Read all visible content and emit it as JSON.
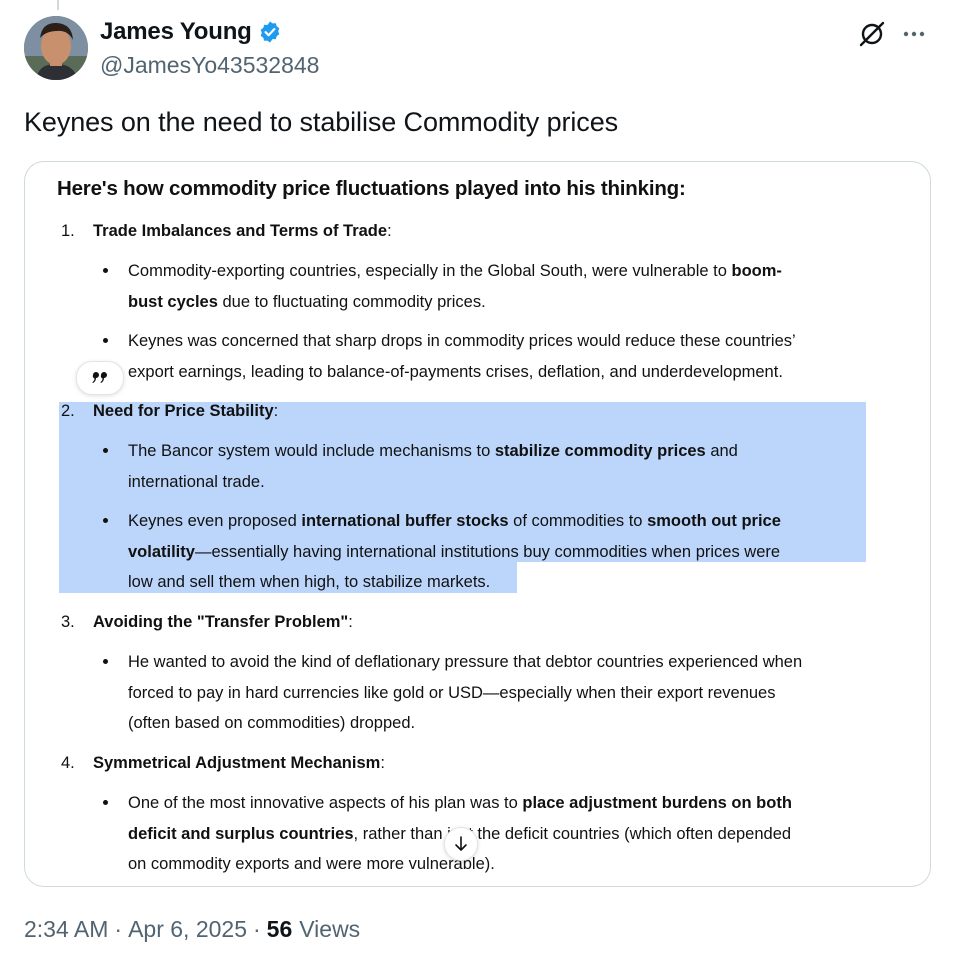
{
  "author": {
    "name": "James Young",
    "handle": "@JamesYo43532848",
    "verified": true,
    "verified_color": "#1d9bf0",
    "avatar": "profile-photo"
  },
  "header_icons": [
    "grok-icon",
    "more-icon"
  ],
  "tweet": {
    "text": "Keynes on the need to stabilise Commodity prices"
  },
  "image_doc": {
    "heading": "Here's how commodity price fluctuations played into his thinking:",
    "sections": [
      {
        "num": "1.",
        "title": "Trade Imbalances and Terms of Trade",
        "lines": [
          "Commodity-exporting countries, especially in the Global South, were vulnerable to boom-",
          "bust cycles due to fluctuating commodity prices.",
          "Keynes was concerned that sharp drops in commodity prices would reduce these countries’",
          "export earnings, leading to balance-of-payments crises, deflation, and underdevelopment."
        ]
      },
      {
        "num": "2.",
        "title": "Need for Price Stability",
        "lines": [
          "The Bancor system would include mechanisms to stabilize commodity prices and",
          "international trade.",
          "Keynes even proposed international buffer stocks of commodities to smooth out price",
          "volatility—essentially having international institutions buy commodities when prices were",
          "low and sell them when high, to stabilize markets."
        ]
      },
      {
        "num": "3.",
        "title": "Avoiding the \"Transfer Problem\"",
        "lines": [
          "He wanted to avoid the kind of deflationary pressure that debtor countries experienced when",
          "forced to pay in hard currencies like gold or USD—especially when their export revenues",
          "(often based on commodities) dropped."
        ]
      },
      {
        "num": "4.",
        "title": "Symmetrical Adjustment Mechanism",
        "lines": [
          "One of the most innovative aspects of his plan was to place adjustment burdens on both",
          "deficit and surplus countries, rather than just the deficit countries (which often depended",
          "on commodity exports and were more vulnerable)."
        ]
      }
    ],
    "highlight_color": "#bcd6fb",
    "quote_button": "quote-icon",
    "scroll_button": "arrow-down-icon"
  },
  "meta": {
    "time": "2:34 AM",
    "separator": "·",
    "date": "Apr 6, 2025",
    "views_count": "56",
    "views_label": "Views"
  }
}
